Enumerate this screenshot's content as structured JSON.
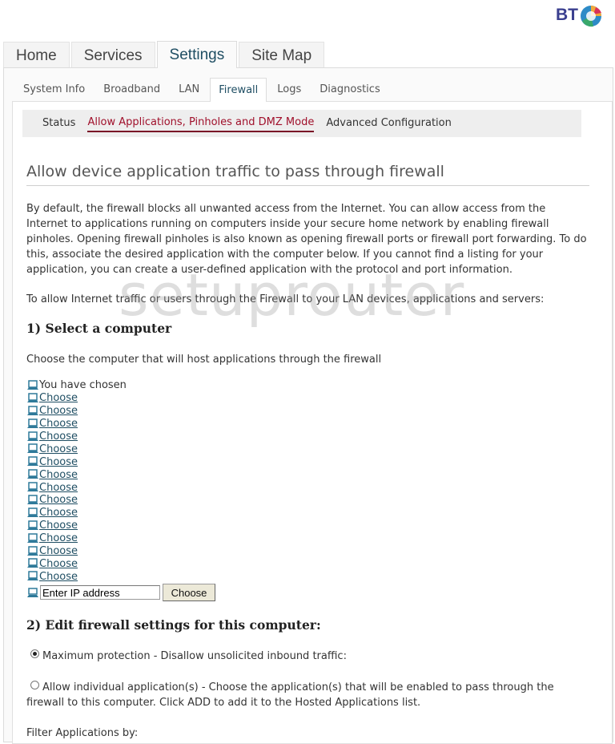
{
  "brand": {
    "logo_text": "BT",
    "colors": {
      "navy": "#3a3f8f",
      "accent_red": "#a0102b",
      "link": "#1f4e63"
    }
  },
  "main_tabs": [
    {
      "label": "Home",
      "active": false
    },
    {
      "label": "Services",
      "active": false
    },
    {
      "label": "Settings",
      "active": true
    },
    {
      "label": "Site Map",
      "active": false
    }
  ],
  "sub_tabs": [
    {
      "label": "System Info",
      "active": false
    },
    {
      "label": "Broadband",
      "active": false
    },
    {
      "label": "LAN",
      "active": false
    },
    {
      "label": "Firewall",
      "active": true
    },
    {
      "label": "Logs",
      "active": false
    },
    {
      "label": "Diagnostics",
      "active": false
    }
  ],
  "third_nav": [
    {
      "label": "Status",
      "active": false
    },
    {
      "label": "Allow Applications, Pinholes and DMZ Mode",
      "active": true
    },
    {
      "label": "Advanced Configuration",
      "active": false
    }
  ],
  "page": {
    "title": "Allow device application traffic to pass through firewall",
    "intro": "By default, the firewall blocks all unwanted access from the Internet. You can allow access from the Internet to applications running on computers inside your secure home network by enabling firewall pinholes. Opening firewall pinholes is also known as opening firewall ports or firewall port forwarding. To do this, associate the desired application with the computer below. If you cannot find a listing for your application, you can create a user-defined application with the protocol and port information.",
    "lead": "To allow Internet traffic or users through the Firewall to your LAN devices, applications and servers:",
    "watermark": "setuprouter"
  },
  "section1": {
    "heading": "1) Select a computer",
    "description": "Choose the computer that will host applications through the firewall",
    "chosen_label": "You have chosen",
    "computers": [
      {
        "label": "Choose"
      },
      {
        "label": "Choose"
      },
      {
        "label": "Choose"
      },
      {
        "label": "Choose"
      },
      {
        "label": "Choose"
      },
      {
        "label": "Choose"
      },
      {
        "label": "Choose"
      },
      {
        "label": "Choose"
      },
      {
        "label": "Choose"
      },
      {
        "label": "Choose"
      },
      {
        "label": "Choose"
      },
      {
        "label": "Choose"
      },
      {
        "label": "Choose"
      },
      {
        "label": "Choose"
      },
      {
        "label": "Choose"
      }
    ],
    "ip_input_value": "Enter IP address",
    "ip_button_label": "Choose"
  },
  "section2": {
    "heading": "2) Edit firewall settings for this computer:",
    "options": [
      {
        "label": "Maximum protection - Disallow unsolicited inbound traffic:",
        "checked": true
      },
      {
        "label": "Allow individual application(s) - Choose the application(s) that will be enabled to pass through the firewall to this computer. Click ADD to add it to the Hosted Applications list.",
        "checked": false
      }
    ],
    "filter_label": "Filter Applications by:"
  }
}
